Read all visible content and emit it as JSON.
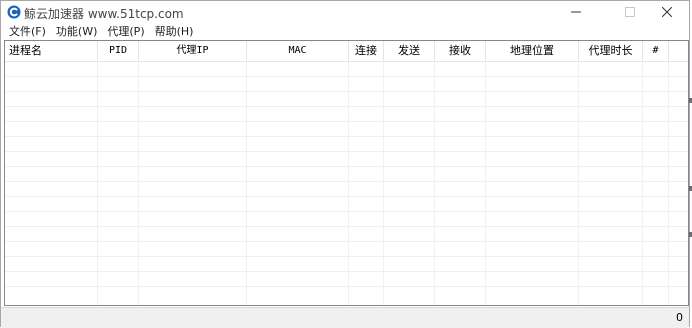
{
  "window": {
    "title": "鲸云加速器  www.51tcp.com",
    "icon": "app-logo-icon",
    "accent_color": "#1565c0"
  },
  "menu": [
    {
      "label": "文件(F)"
    },
    {
      "label": "功能(W)"
    },
    {
      "label": "代理(P)"
    },
    {
      "label": "帮助(H)"
    }
  ],
  "table": {
    "columns": [
      {
        "label": "进程名"
      },
      {
        "label": "PID"
      },
      {
        "label": "代理IP"
      },
      {
        "label": "MAC"
      },
      {
        "label": "连接"
      },
      {
        "label": "发送"
      },
      {
        "label": "接收"
      },
      {
        "label": "地理位置"
      },
      {
        "label": "代理时长"
      },
      {
        "label": "#"
      }
    ],
    "rows": []
  },
  "status": {
    "count": "0"
  }
}
